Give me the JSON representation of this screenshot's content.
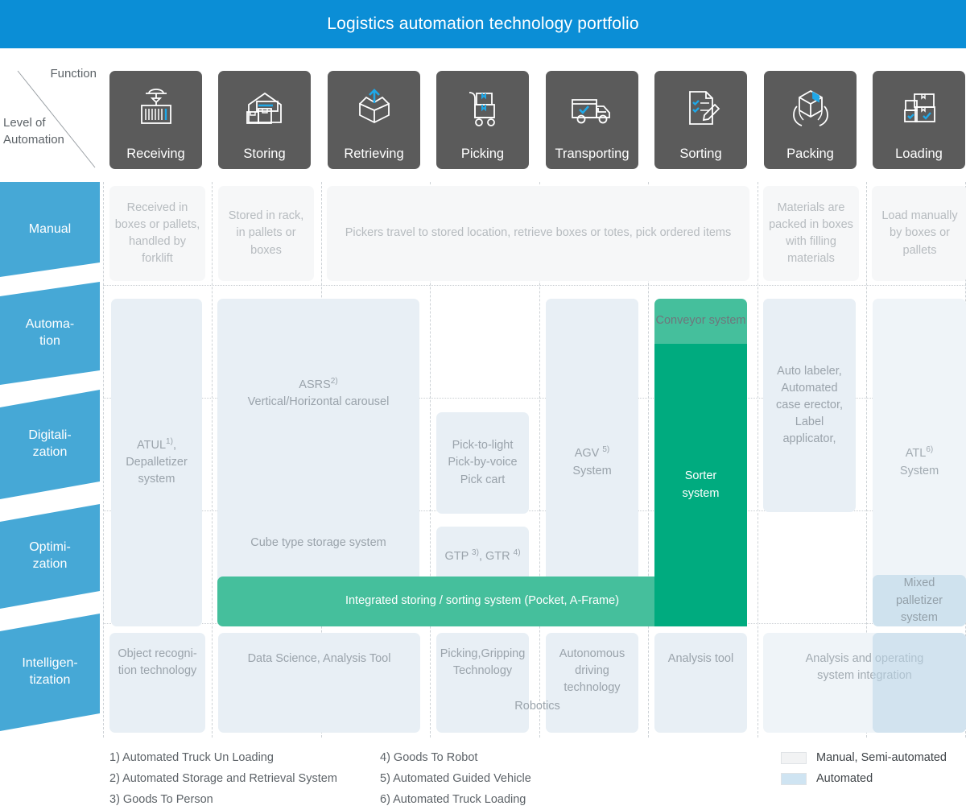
{
  "header": {
    "title": "Logistics automation technology portfolio",
    "bar_color": "#0b8ed6"
  },
  "axes": {
    "x_label": "Function",
    "y_label_line1": "Level of",
    "y_label_line2": "Automation"
  },
  "functions": [
    {
      "label": "Receiving",
      "icon": "container-crane-icon"
    },
    {
      "label": "Storing",
      "icon": "warehouse-icon"
    },
    {
      "label": "Retrieving",
      "icon": "open-box-up-arrow-icon"
    },
    {
      "label": "Picking",
      "icon": "hand-truck-boxes-icon"
    },
    {
      "label": "Transporting",
      "icon": "truck-check-icon"
    },
    {
      "label": "Sorting",
      "icon": "document-checklist-pen-icon"
    },
    {
      "label": "Packing",
      "icon": "hands-box-icon"
    },
    {
      "label": "Loading",
      "icon": "stacked-boxes-check-icon"
    }
  ],
  "levels": [
    {
      "line1": "Manual",
      "line2": ""
    },
    {
      "line1": "Automa-",
      "line2": "tion"
    },
    {
      "line1": "Digitali-",
      "line2": "zation"
    },
    {
      "line1": "Optimi-",
      "line2": "zation"
    },
    {
      "line1": "Intelligen-",
      "line2": "tization"
    }
  ],
  "cells": {
    "manual_receiving": "Received in boxes or pallets, handled by forklift",
    "manual_storing": "Stored in rack, in pallets or boxes",
    "manual_pick_span": "Pickers  travel to stored location, retrieve boxes or totes, pick ordered items",
    "manual_packing": "Materials are packed in boxes with filling materials",
    "manual_loading": "Load manually by boxes or pallets",
    "atul": "ATUL",
    "atul_sup": "1)",
    "atul_rest": ", Depalletizer system",
    "asrs": "ASRS",
    "asrs_sup": "2)",
    "asrs_rest": "Vertical/Horizontal carousel",
    "pick_light": "Pick-to-light Pick-by-voice Pick cart",
    "agv": "AGV",
    "agv_sup": "5)",
    "agv_rest": "System",
    "conveyor": "Conveyor system",
    "sorter": "Sorter system",
    "packing_auto": "Auto labeler, Automated case erector, Label applicator,",
    "atl": "ATL",
    "atl_sup": "6)",
    "atl_rest": "System",
    "cube_storage": "Cube type storage system",
    "gtp": "GTP",
    "gtp_sup": "3)",
    "gtr": ", GTR",
    "gtr_sup": "4)",
    "integrated": "Integrated storing / sorting system (Pocket, A-Frame)",
    "mixed_palletizer": "Mixed palletizer system",
    "object_recognition": "Object recogni-tion technology",
    "data_science": "Data Science, Analysis Tool",
    "picking_gripping": "Picking,Gripping Technology",
    "autonomous_driving": "Autonomous driving technology",
    "analysis_tool": "Analysis tool",
    "analysis_operating": "Analysis and operating system integration",
    "robotics": "Robotics"
  },
  "footnotes": {
    "col1": [
      "1) Automated Truck Un Loading",
      "2) Automated Storage and Retrieval System",
      "3) Goods To Person"
    ],
    "col2": [
      "4) Goods To Robot",
      "5) Automated Guided Vehicle",
      "6) Automated Truck Loading"
    ]
  },
  "legend": [
    {
      "label": "Manual, Semi-automated",
      "color": "#f2f3f4"
    },
    {
      "label": "Automated",
      "color": "#cfe4f2"
    }
  ]
}
